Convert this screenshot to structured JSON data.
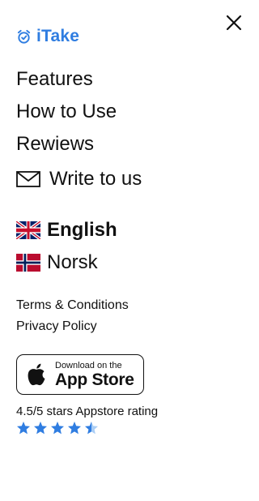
{
  "brand": {
    "name": "iTake",
    "icon": "alarm-clock-icon",
    "color": "#2f7de1"
  },
  "close": {
    "icon": "close-icon"
  },
  "nav": {
    "items": [
      {
        "label": "Features"
      },
      {
        "label": "How to Use"
      },
      {
        "label": "Rewiews"
      }
    ]
  },
  "contact": {
    "label": "Write to us",
    "icon": "envelope-icon"
  },
  "languages": [
    {
      "label": "English",
      "flag": "uk-flag-icon",
      "selected": true
    },
    {
      "label": "Norsk",
      "flag": "norway-flag-icon",
      "selected": false
    }
  ],
  "legal": {
    "terms": "Terms & Conditions",
    "privacy": "Privacy Policy"
  },
  "appstore": {
    "line1": "Download on the",
    "line2": "App Store",
    "icon": "apple-icon"
  },
  "rating": {
    "text": "4.5/5 stars Appstore rating",
    "value": 4.5,
    "max": 5,
    "star_color": "#2f7de1"
  }
}
